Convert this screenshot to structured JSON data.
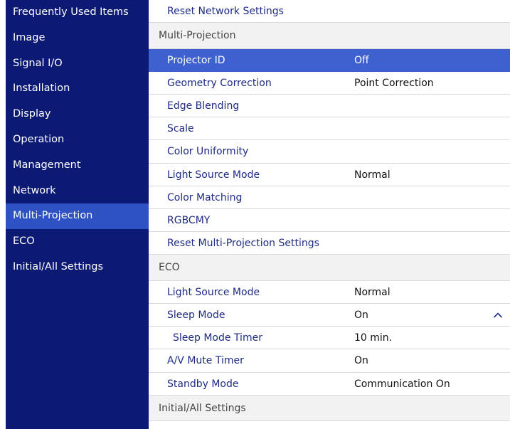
{
  "sidebar": {
    "items": [
      {
        "label": "Frequently Used Items"
      },
      {
        "label": "Image"
      },
      {
        "label": "Signal I/O"
      },
      {
        "label": "Installation"
      },
      {
        "label": "Display"
      },
      {
        "label": "Operation"
      },
      {
        "label": "Management"
      },
      {
        "label": "Network"
      },
      {
        "label": "Multi-Projection",
        "selected": true
      },
      {
        "label": "ECO"
      },
      {
        "label": "Initial/All Settings"
      }
    ]
  },
  "main": {
    "network_tail": {
      "label": "Reset Network Settings"
    },
    "multi_projection": {
      "header": "Multi-Projection",
      "rows": [
        {
          "label": "Projector ID",
          "value": "Off",
          "selected": true
        },
        {
          "label": "Geometry Correction",
          "value": "Point Correction"
        },
        {
          "label": "Edge Blending",
          "value": ""
        },
        {
          "label": "Scale",
          "value": ""
        },
        {
          "label": "Color Uniformity",
          "value": ""
        },
        {
          "label": "Light Source Mode",
          "value": "Normal"
        },
        {
          "label": "Color Matching",
          "value": ""
        },
        {
          "label": "RGBCMY",
          "value": ""
        },
        {
          "label": "Reset Multi-Projection Settings",
          "value": ""
        }
      ]
    },
    "eco": {
      "header": "ECO",
      "rows": [
        {
          "label": "Light Source Mode",
          "value": "Normal"
        },
        {
          "label": "Sleep Mode",
          "value": "On",
          "expanded_icon": "chevron-up-icon"
        },
        {
          "label": "Sleep Mode Timer",
          "value": "10 min.",
          "indent": true
        },
        {
          "label": "A/V Mute Timer",
          "value": "On"
        },
        {
          "label": "Standby Mode",
          "value": "Communication On"
        }
      ]
    },
    "initial": {
      "header": "Initial/All Settings"
    }
  },
  "colors": {
    "sidebar_bg": "#0d1a73",
    "sidebar_selected": "#2e52c4",
    "row_selected": "#3f61cf",
    "label_text": "#1e2b86",
    "section_bg": "#f2f2f2"
  }
}
